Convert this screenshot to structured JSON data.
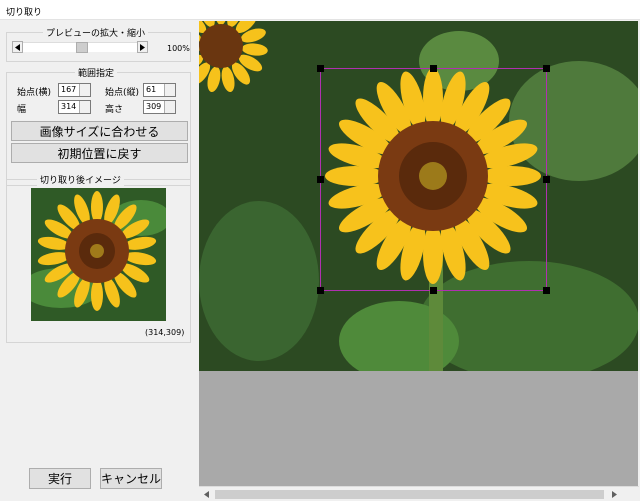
{
  "window": {
    "title": "切り取り"
  },
  "zoom": {
    "legend": "プレビューの拡大・縮小",
    "value_label": "100%",
    "slider_fraction": 0.5
  },
  "range": {
    "legend": "範囲指定",
    "x_label": "始点(横)",
    "x_value": "167",
    "y_label": "始点(縦)",
    "y_value": "61",
    "w_label": "幅",
    "w_value": "314",
    "h_label": "高さ",
    "h_value": "309",
    "fit_button": "画像サイズに合わせる",
    "reset_button": "初期位置に戻す"
  },
  "preview": {
    "legend": "切り取り後イメージ",
    "size_label": "(314,309)"
  },
  "actions": {
    "run": "実行",
    "cancel": "キャンセル"
  },
  "colors": {
    "selection": "#b030b0",
    "canvas_bg": "#a9a9a9"
  }
}
